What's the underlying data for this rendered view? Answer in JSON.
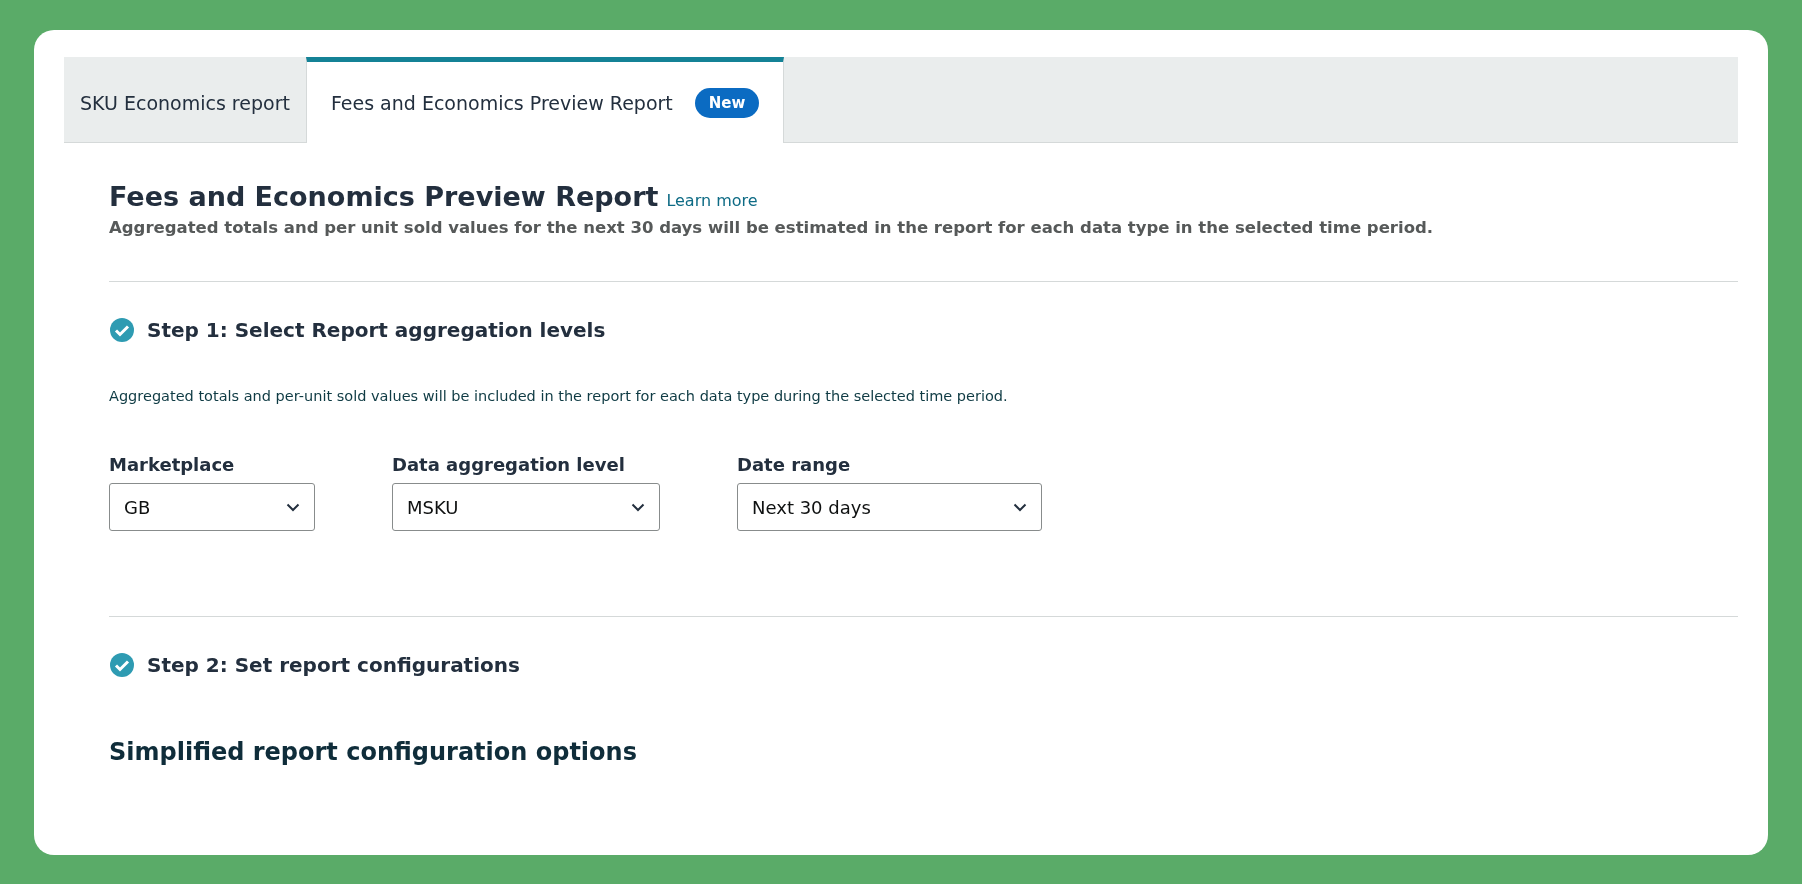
{
  "tabs": [
    {
      "label": "SKU Economics report",
      "selected": false
    },
    {
      "label": "Fees and Economics Preview Report",
      "selected": true,
      "badge": "New"
    }
  ],
  "header": {
    "title": "Fees and Economics Preview Report",
    "link": "Learn more",
    "description": "Aggregated totals and per unit sold values for the next 30 days will be estimated in the report for each data type in the selected time period."
  },
  "steps": [
    {
      "title": "Step 1: Select Report aggregation levels",
      "completed": true,
      "description": "Aggregated totals and per-unit sold values will be included in the report for each data type during the selected time period.",
      "fields": [
        {
          "label": "Marketplace",
          "value": "GB"
        },
        {
          "label": "Data aggregation level",
          "value": "MSKU"
        },
        {
          "label": "Date range",
          "value": "Next 30 days"
        }
      ]
    },
    {
      "title": "Step 2: Set report configurations",
      "completed": true
    }
  ],
  "section": {
    "title": "Simplified report configuration options"
  }
}
